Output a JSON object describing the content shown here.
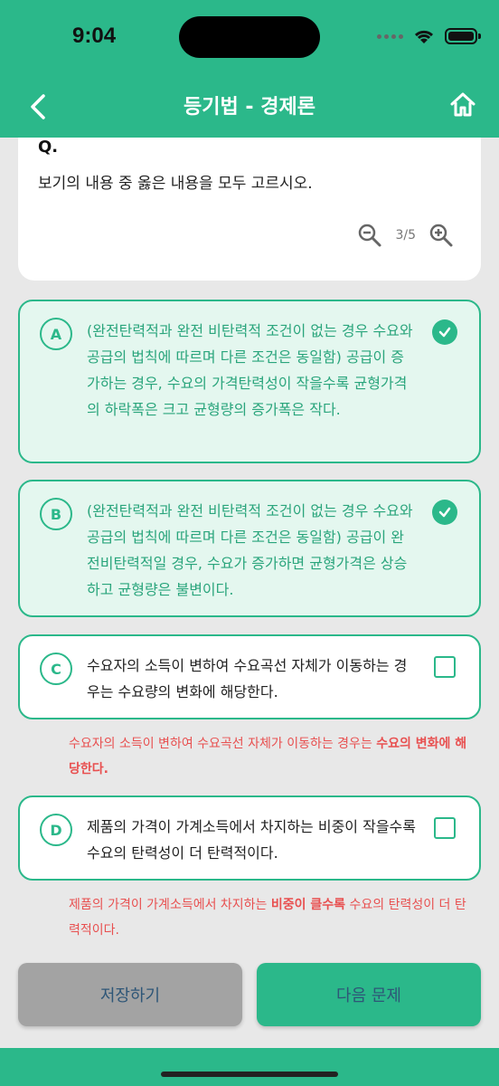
{
  "status": {
    "time": "9:04"
  },
  "header": {
    "title": "등기법 - 경제론"
  },
  "question": {
    "label": "Q.",
    "text": "보기의 내용 중 옳은 내용을 모두 고르시오.",
    "zoom": "3/5"
  },
  "options": [
    {
      "letter": "A",
      "text": "(완전탄력적과 완전 비탄력적 조건이 없는 경우 수요와 공급의 법칙에 따르며 다른 조건은 동일함) 공급이 증가하는 경우, 수요의 가격탄력성이 작을수록 균형가격의 하락폭은 크고 균형량의 증가폭은 작다.",
      "checked": true
    },
    {
      "letter": "B",
      "text": "(완전탄력적과 완전 비탄력적 조건이 없는 경우 수요와 공급의 법칙에 따르며 다른 조건은 동일함) 공급이 완전비탄력적일 경우, 수요가 증가하면 균형가격은 상승하고 균형량은 불변이다.",
      "checked": true
    },
    {
      "letter": "C",
      "text": "수요자의 소득이 변하여 수요곡선 자체가 이동하는 경우는 수요량의 변화에 해당한다.",
      "checked": false
    },
    {
      "letter": "D",
      "text": "제품의 가격이 가계소득에서 차지하는 비중이 작을수록 수요의 탄력성이 더 탄력적이다.",
      "checked": false
    }
  ],
  "feedback": {
    "c_pre": "수요자의 소득이 변하여 수요곡선 자체가 이동하는 경우는 ",
    "c_bold": "수요의 변화에 해당한다.",
    "d_pre": "제품의 가격이 가계소득에서 차지하는 ",
    "d_bold": "비중이 클수록",
    "d_post": " 수요의 탄력성이 더 탄력적이다."
  },
  "buttons": {
    "save": "저장하기",
    "next": "다음 문제"
  },
  "colors": {
    "accent": "#2bb88a",
    "error": "#e85050"
  }
}
